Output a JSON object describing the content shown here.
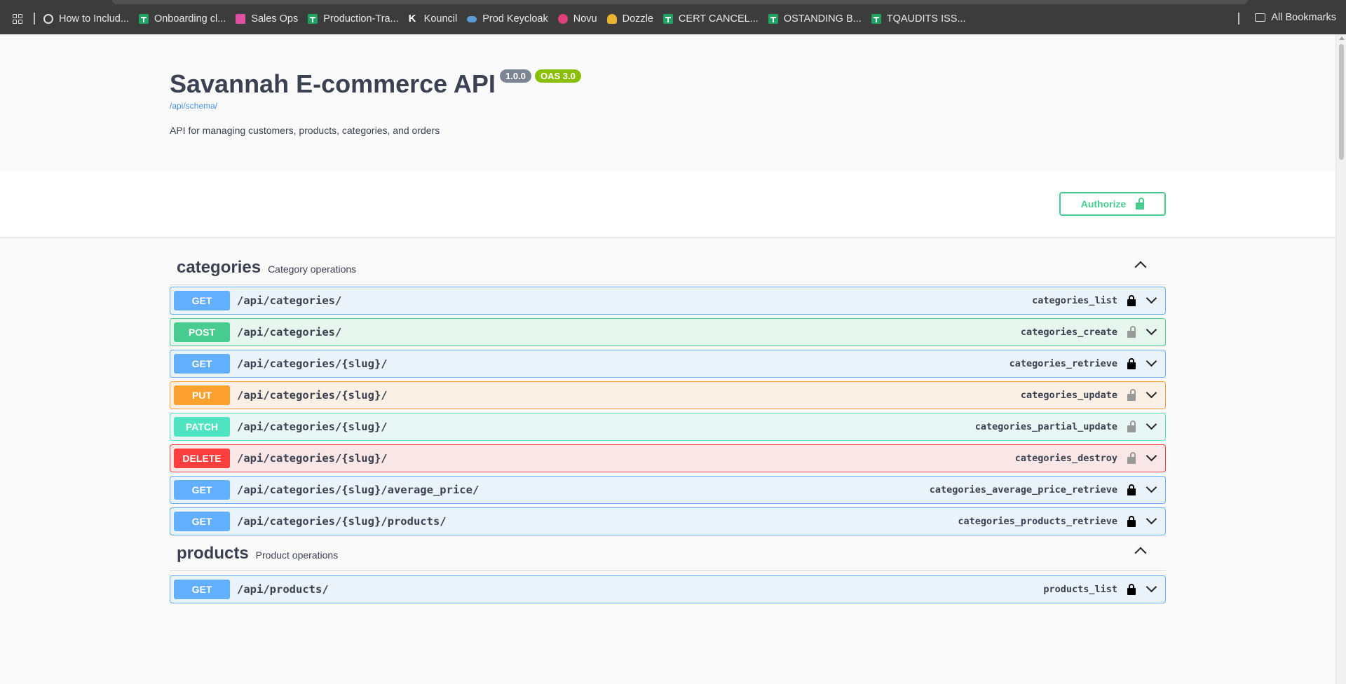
{
  "bookmarks": [
    {
      "label": "How to Includ...",
      "icon": "globe-icon"
    },
    {
      "label": "Onboarding cl...",
      "icon": "sheets-icon"
    },
    {
      "label": "Sales Ops",
      "icon": "sales-ops-icon"
    },
    {
      "label": "Production-Tra...",
      "icon": "sheets-icon"
    },
    {
      "label": "Kouncil",
      "icon": "kouncil-icon"
    },
    {
      "label": "Prod Keycloak",
      "icon": "keycloak-icon"
    },
    {
      "label": "Novu",
      "icon": "novu-icon"
    },
    {
      "label": "Dozzle",
      "icon": "dozzle-icon"
    },
    {
      "label": "CERT CANCEL...",
      "icon": "sheets-icon"
    },
    {
      "label": "OSTANDING B...",
      "icon": "sheets-icon"
    },
    {
      "label": "TQAUDITS ISS...",
      "icon": "sheets-icon"
    }
  ],
  "all_bookmarks_label": "All Bookmarks",
  "info": {
    "title": "Savannah E-commerce API",
    "version": "1.0.0",
    "oas": "OAS 3.0",
    "schema_url": "/api/schema/",
    "description": "API for managing customers, products, categories, and orders"
  },
  "authorize_label": "Authorize",
  "tags": [
    {
      "name": "categories",
      "description": "Category operations",
      "operations": [
        {
          "method": "GET",
          "path": "/api/categories/",
          "operation_id": "categories_list",
          "locked": true
        },
        {
          "method": "POST",
          "path": "/api/categories/",
          "operation_id": "categories_create",
          "locked": false
        },
        {
          "method": "GET",
          "path": "/api/categories/{slug}/",
          "operation_id": "categories_retrieve",
          "locked": true
        },
        {
          "method": "PUT",
          "path": "/api/categories/{slug}/",
          "operation_id": "categories_update",
          "locked": false
        },
        {
          "method": "PATCH",
          "path": "/api/categories/{slug}/",
          "operation_id": "categories_partial_update",
          "locked": false
        },
        {
          "method": "DELETE",
          "path": "/api/categories/{slug}/",
          "operation_id": "categories_destroy",
          "locked": false
        },
        {
          "method": "GET",
          "path": "/api/categories/{slug}/average_price/",
          "operation_id": "categories_average_price_retrieve",
          "locked": true
        },
        {
          "method": "GET",
          "path": "/api/categories/{slug}/products/",
          "operation_id": "categories_products_retrieve",
          "locked": true
        }
      ]
    },
    {
      "name": "products",
      "description": "Product operations",
      "operations": [
        {
          "method": "GET",
          "path": "/api/products/",
          "operation_id": "products_list",
          "locked": true
        }
      ]
    }
  ],
  "colors": {
    "get": "#61affe",
    "post": "#49cc90",
    "put": "#fca130",
    "patch": "#50e3c2",
    "delete": "#f93e3e"
  }
}
